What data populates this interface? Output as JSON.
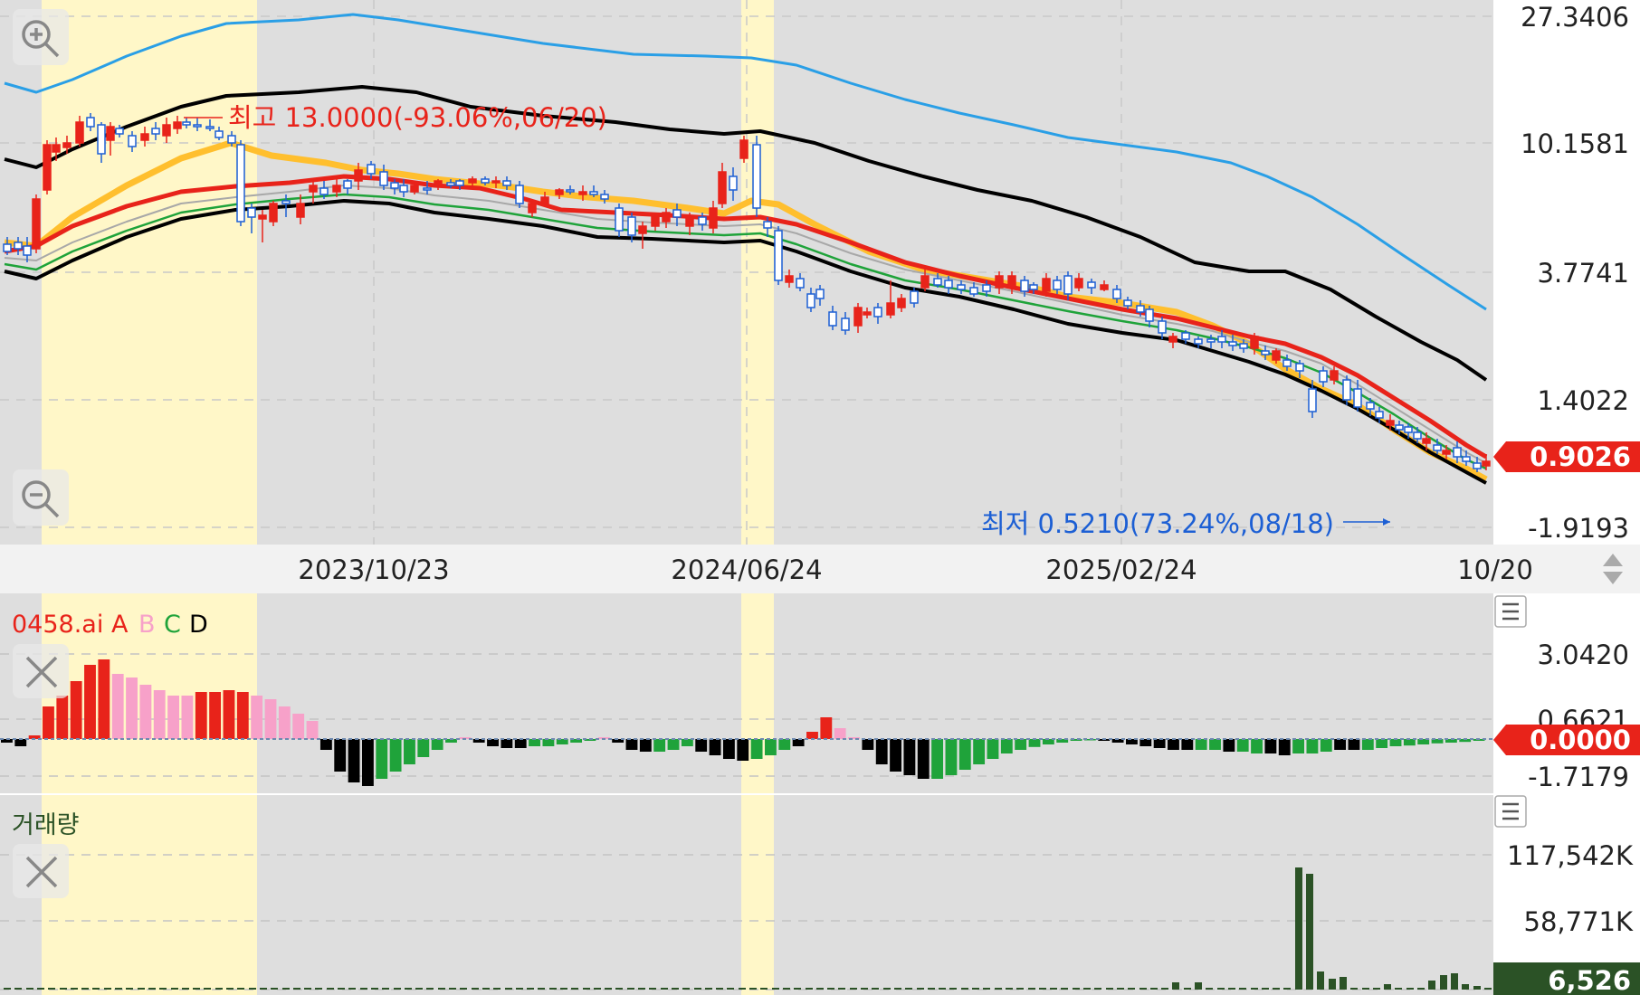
{
  "chart_data": {
    "type": "candlestick",
    "price_panel": {
      "scale": "log",
      "y_ticks": [
        "27.3406",
        "10.1581",
        "3.7741",
        "1.4022",
        "-1.9193"
      ],
      "current_price": "0.9026",
      "high_annotation": "최고 13.0000(-93.06%,06/20)",
      "low_annotation": "최저 0.5210(73.24%,08/18)",
      "series": [
        {
          "name": "candles",
          "color_up": "#e8231a",
          "color_down": "#1c5fd4"
        },
        {
          "name": "upper-band-blue",
          "color": "#2a9fe6"
        },
        {
          "name": "upper-band-black",
          "color": "#000000"
        },
        {
          "name": "orange-ma",
          "color": "#ffbf2e"
        },
        {
          "name": "red-ma",
          "color": "#e8231a"
        },
        {
          "name": "gray-ma",
          "color": "#a8a8a8"
        },
        {
          "name": "green-ma",
          "color": "#1fa33a"
        },
        {
          "name": "lower-band-black",
          "color": "#000000"
        }
      ]
    },
    "x_ticks": [
      "2023/10/23",
      "2024/06/24",
      "2025/02/24",
      "10/20"
    ],
    "indicator_panel": {
      "title": "0458.ai",
      "legend": [
        {
          "label": "A",
          "color": "#e8231a"
        },
        {
          "label": "B",
          "color": "#f7a1c9"
        },
        {
          "label": "C",
          "color": "#1fa33a"
        },
        {
          "label": "D",
          "color": "#000000"
        }
      ],
      "y_ticks": [
        "3.0420",
        "0.6621",
        "-1.7179"
      ],
      "current_value": "0.0000",
      "bars": [
        {
          "v": -0.1,
          "c": "D"
        },
        {
          "v": -0.2,
          "c": "D"
        },
        {
          "v": 0.1,
          "c": "A"
        },
        {
          "v": 0.9,
          "c": "A"
        },
        {
          "v": 1.2,
          "c": "A"
        },
        {
          "v": 1.6,
          "c": "A"
        },
        {
          "v": 2.05,
          "c": "A"
        },
        {
          "v": 2.2,
          "c": "A"
        },
        {
          "v": 1.8,
          "c": "B"
        },
        {
          "v": 1.7,
          "c": "B"
        },
        {
          "v": 1.5,
          "c": "B"
        },
        {
          "v": 1.35,
          "c": "B"
        },
        {
          "v": 1.2,
          "c": "B"
        },
        {
          "v": 1.2,
          "c": "B"
        },
        {
          "v": 1.3,
          "c": "A"
        },
        {
          "v": 1.3,
          "c": "A"
        },
        {
          "v": 1.35,
          "c": "A"
        },
        {
          "v": 1.3,
          "c": "A"
        },
        {
          "v": 1.2,
          "c": "B"
        },
        {
          "v": 1.1,
          "c": "B"
        },
        {
          "v": 0.9,
          "c": "B"
        },
        {
          "v": 0.7,
          "c": "B"
        },
        {
          "v": 0.5,
          "c": "B"
        },
        {
          "v": -0.3,
          "c": "D"
        },
        {
          "v": -0.9,
          "c": "D"
        },
        {
          "v": -1.2,
          "c": "D"
        },
        {
          "v": -1.3,
          "c": "D"
        },
        {
          "v": -1.1,
          "c": "C"
        },
        {
          "v": -0.9,
          "c": "C"
        },
        {
          "v": -0.7,
          "c": "C"
        },
        {
          "v": -0.5,
          "c": "C"
        },
        {
          "v": -0.3,
          "c": "C"
        },
        {
          "v": -0.1,
          "c": "C"
        },
        {
          "v": 0.05,
          "c": "B"
        },
        {
          "v": -0.1,
          "c": "D"
        },
        {
          "v": -0.2,
          "c": "D"
        },
        {
          "v": -0.25,
          "c": "D"
        },
        {
          "v": -0.25,
          "c": "D"
        },
        {
          "v": -0.2,
          "c": "C"
        },
        {
          "v": -0.2,
          "c": "C"
        },
        {
          "v": -0.15,
          "c": "C"
        },
        {
          "v": -0.1,
          "c": "C"
        },
        {
          "v": -0.05,
          "c": "C"
        },
        {
          "v": 0.05,
          "c": "B"
        },
        {
          "v": -0.1,
          "c": "D"
        },
        {
          "v": -0.3,
          "c": "D"
        },
        {
          "v": -0.35,
          "c": "D"
        },
        {
          "v": -0.35,
          "c": "C"
        },
        {
          "v": -0.3,
          "c": "C"
        },
        {
          "v": -0.2,
          "c": "C"
        },
        {
          "v": -0.35,
          "c": "D"
        },
        {
          "v": -0.45,
          "c": "D"
        },
        {
          "v": -0.55,
          "c": "D"
        },
        {
          "v": -0.6,
          "c": "D"
        },
        {
          "v": -0.55,
          "c": "C"
        },
        {
          "v": -0.45,
          "c": "C"
        },
        {
          "v": -0.3,
          "c": "C"
        },
        {
          "v": -0.2,
          "c": "D"
        },
        {
          "v": 0.2,
          "c": "A"
        },
        {
          "v": 0.6,
          "c": "A"
        },
        {
          "v": 0.3,
          "c": "B"
        },
        {
          "v": 0.05,
          "c": "B"
        },
        {
          "v": -0.3,
          "c": "D"
        },
        {
          "v": -0.7,
          "c": "D"
        },
        {
          "v": -0.9,
          "c": "D"
        },
        {
          "v": -1.0,
          "c": "D"
        },
        {
          "v": -1.1,
          "c": "D"
        },
        {
          "v": -1.1,
          "c": "C"
        },
        {
          "v": -1.0,
          "c": "C"
        },
        {
          "v": -0.85,
          "c": "C"
        },
        {
          "v": -0.7,
          "c": "C"
        },
        {
          "v": -0.55,
          "c": "C"
        },
        {
          "v": -0.4,
          "c": "C"
        },
        {
          "v": -0.3,
          "c": "C"
        },
        {
          "v": -0.22,
          "c": "C"
        },
        {
          "v": -0.15,
          "c": "C"
        },
        {
          "v": -0.1,
          "c": "C"
        },
        {
          "v": -0.05,
          "c": "C"
        },
        {
          "v": -0.03,
          "c": "C"
        },
        {
          "v": -0.05,
          "c": "D"
        },
        {
          "v": -0.1,
          "c": "D"
        },
        {
          "v": -0.15,
          "c": "D"
        },
        {
          "v": -0.2,
          "c": "D"
        },
        {
          "v": -0.25,
          "c": "D"
        },
        {
          "v": -0.3,
          "c": "D"
        },
        {
          "v": -0.3,
          "c": "D"
        },
        {
          "v": -0.3,
          "c": "C"
        },
        {
          "v": -0.3,
          "c": "C"
        },
        {
          "v": -0.35,
          "c": "D"
        },
        {
          "v": -0.35,
          "c": "C"
        },
        {
          "v": -0.4,
          "c": "C"
        },
        {
          "v": -0.4,
          "c": "D"
        },
        {
          "v": -0.45,
          "c": "D"
        },
        {
          "v": -0.4,
          "c": "C"
        },
        {
          "v": -0.4,
          "c": "C"
        },
        {
          "v": -0.35,
          "c": "C"
        },
        {
          "v": -0.3,
          "c": "D"
        },
        {
          "v": -0.3,
          "c": "D"
        },
        {
          "v": -0.3,
          "c": "C"
        },
        {
          "v": -0.25,
          "c": "C"
        },
        {
          "v": -0.2,
          "c": "C"
        },
        {
          "v": -0.18,
          "c": "C"
        },
        {
          "v": -0.15,
          "c": "C"
        },
        {
          "v": -0.12,
          "c": "C"
        },
        {
          "v": -0.1,
          "c": "C"
        },
        {
          "v": -0.08,
          "c": "C"
        },
        {
          "v": -0.05,
          "c": "C"
        }
      ]
    },
    "volume_panel": {
      "title": "거래량",
      "y_ticks": [
        "117,542K",
        "58,771K"
      ],
      "current_value": "6,526",
      "color": "#2b5226"
    }
  },
  "ui": {
    "colors": {
      "panel_bg": "#dedede",
      "highlight": "#fff7c8",
      "axis_bg": "#ffffff",
      "xaxis_bg": "#f2f2f2"
    },
    "icons": [
      "zoom-in-icon",
      "zoom-out-icon",
      "close-icon",
      "menu-icon",
      "scroll-arrows-icon"
    ]
  }
}
